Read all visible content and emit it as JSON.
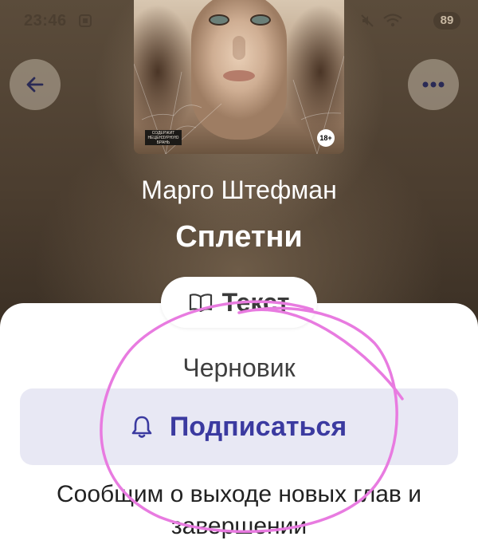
{
  "status_bar": {
    "time": "23:46",
    "battery": "89",
    "icons": [
      "screenshot-icon",
      "mute-icon",
      "wifi-icon",
      "battery-icon"
    ]
  },
  "book": {
    "cover": {
      "age_rating": "18+",
      "publisher_badge": "СОДЕРЖИТ НЕЦЕНЗУРНУЮ БРАНЬ"
    },
    "author": "Марго Штефман",
    "title": "Сплетни"
  },
  "nav": {
    "back_icon": "arrow-left-icon",
    "more_icon": "more-dots-icon"
  },
  "sheet": {
    "format_label": "Текст",
    "format_icon": "book-open-icon",
    "status_label": "Черновик",
    "subscribe_label": "Подписаться",
    "subscribe_icon": "bell-icon",
    "notice": "Сообщим о выходе новых глав и завершении"
  },
  "colors": {
    "accent": "#3b3aa0",
    "subscribe_bg": "#e8e8f4",
    "annotation": "#e87be0"
  }
}
